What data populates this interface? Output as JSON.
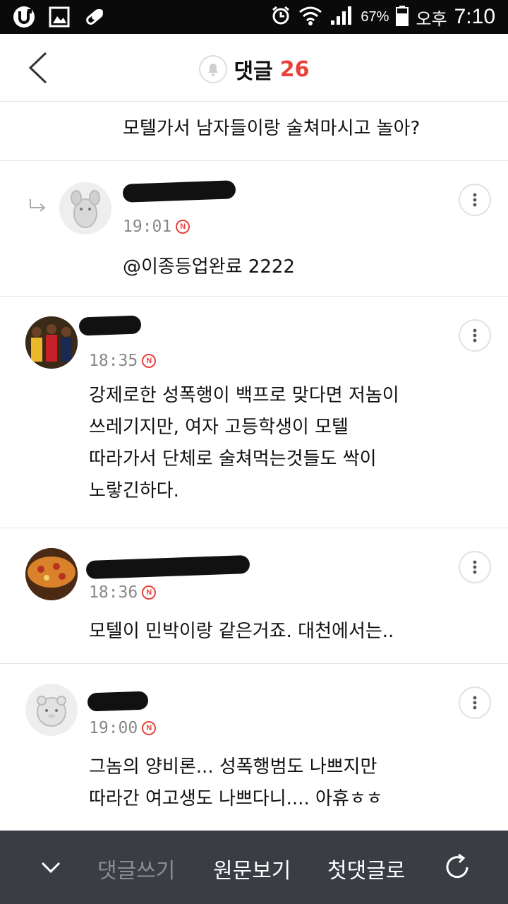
{
  "status_bar": {
    "battery_percent": "67%",
    "ampm": "오후",
    "time": "7:10"
  },
  "header": {
    "title": "댓글",
    "count": "26"
  },
  "comments": [
    {
      "time": "",
      "text": "모텔가서 남자들이랑 술쳐마시고 놀아?"
    },
    {
      "time": "19:01",
      "badge": "N",
      "text": "@이종등업완료 2222"
    },
    {
      "time": "18:35",
      "badge": "N",
      "text": "강제로한 성폭행이 백프로 맞다면 저놈이\n쓰레기지만, 여자 고등학생이 모텔\n따라가서 단체로 술쳐먹는것들도 싹이\n노랗긴하다."
    },
    {
      "time": "18:36",
      "badge": "N",
      "text": "모텔이 민박이랑 같은거죠. 대천에서는.."
    },
    {
      "time": "19:00",
      "badge": "N",
      "text": "그놈의 양비론... 성폭행범도 나쁘지만\n따라간 여고생도 나쁘다니.... 아휴ㅎㅎ"
    }
  ],
  "bottom_bar": {
    "write_label": "댓글쓰기",
    "original_label": "원문보기",
    "first_label": "첫댓글로"
  },
  "colors": {
    "accent": "#e8423a",
    "bottom_bar_bg": "#3a3d44",
    "disabled_text": "#8a8d94"
  }
}
